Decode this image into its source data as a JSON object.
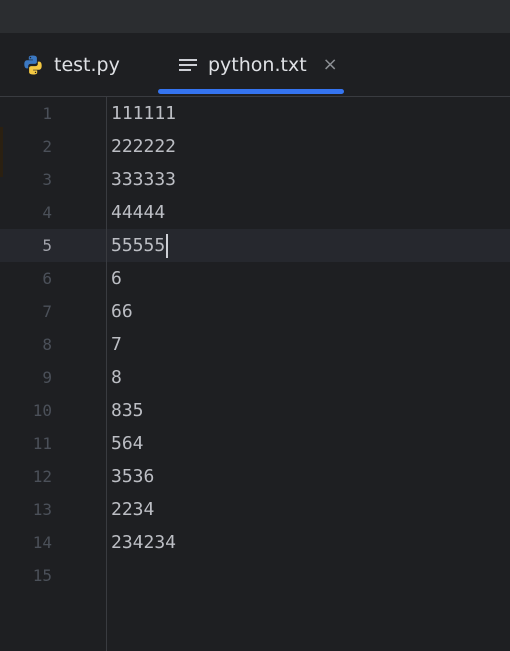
{
  "tabs": [
    {
      "label": "test.py",
      "icon": "python-icon",
      "active": false
    },
    {
      "label": "python.txt",
      "icon": "text-file-icon",
      "active": true,
      "close": "×"
    }
  ],
  "editor": {
    "current_line": 5,
    "lines": [
      {
        "number": "1",
        "text": "111111"
      },
      {
        "number": "2",
        "text": "222222"
      },
      {
        "number": "3",
        "text": "333333"
      },
      {
        "number": "4",
        "text": "44444"
      },
      {
        "number": "5",
        "text": "55555"
      },
      {
        "number": "6",
        "text": "6"
      },
      {
        "number": "7",
        "text": "66"
      },
      {
        "number": "8",
        "text": "7"
      },
      {
        "number": "9",
        "text": "8"
      },
      {
        "number": "10",
        "text": "835"
      },
      {
        "number": "11",
        "text": "564"
      },
      {
        "number": "12",
        "text": "3536"
      },
      {
        "number": "13",
        "text": "2234"
      },
      {
        "number": "14",
        "text": "234234"
      },
      {
        "number": "15",
        "text": ""
      }
    ]
  },
  "colors": {
    "accent": "#3574f0",
    "background": "#1e1f22",
    "text": "#bcbec4",
    "line_number": "#4b5059"
  }
}
